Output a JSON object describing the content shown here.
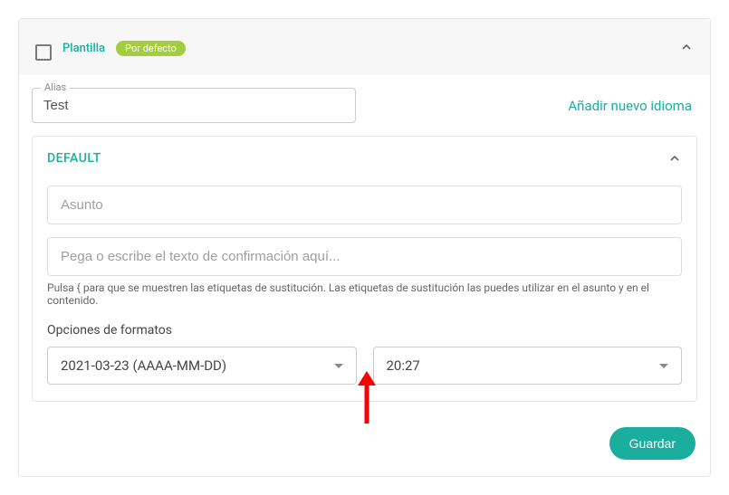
{
  "header": {
    "title": "Plantilla",
    "badge": "Por defecto"
  },
  "alias": {
    "label": "Alias",
    "value": "Test"
  },
  "addLanguage": "Añadir nuevo idioma",
  "inner": {
    "title": "DEFAULT",
    "subjectPlaceholder": "Asunto",
    "bodyPlaceholder": "Pega o escribe el texto de confirmación aquí...",
    "hint": "Pulsa { para que se muestren las etiquetas de sustitución. Las etiquetas de sustitución las puedes utilizar en el asunto y en el contenido.",
    "formatLabel": "Opciones de formatos",
    "dateFormat": "2021-03-23 (AAAA-MM-DD)",
    "timeFormat": "20:27"
  },
  "footer": {
    "save": "Guardar"
  }
}
